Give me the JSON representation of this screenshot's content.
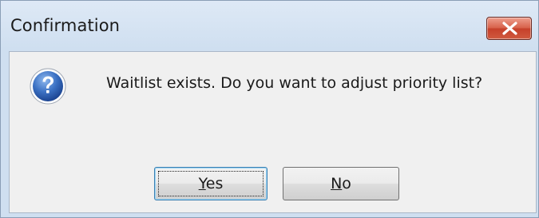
{
  "dialog": {
    "title": "Confirmation",
    "message": "Waitlist exists. Do you want to adjust priority list?",
    "icon": "question-icon",
    "close_icon": "close-icon"
  },
  "buttons": {
    "yes": {
      "mnemonic": "Y",
      "rest": "es"
    },
    "no": {
      "mnemonic": "N",
      "rest": "o"
    }
  },
  "colors": {
    "close_button": "#d05a3f",
    "question_icon": "#2a5fb0",
    "default_button_border": "#3c7fb1"
  }
}
